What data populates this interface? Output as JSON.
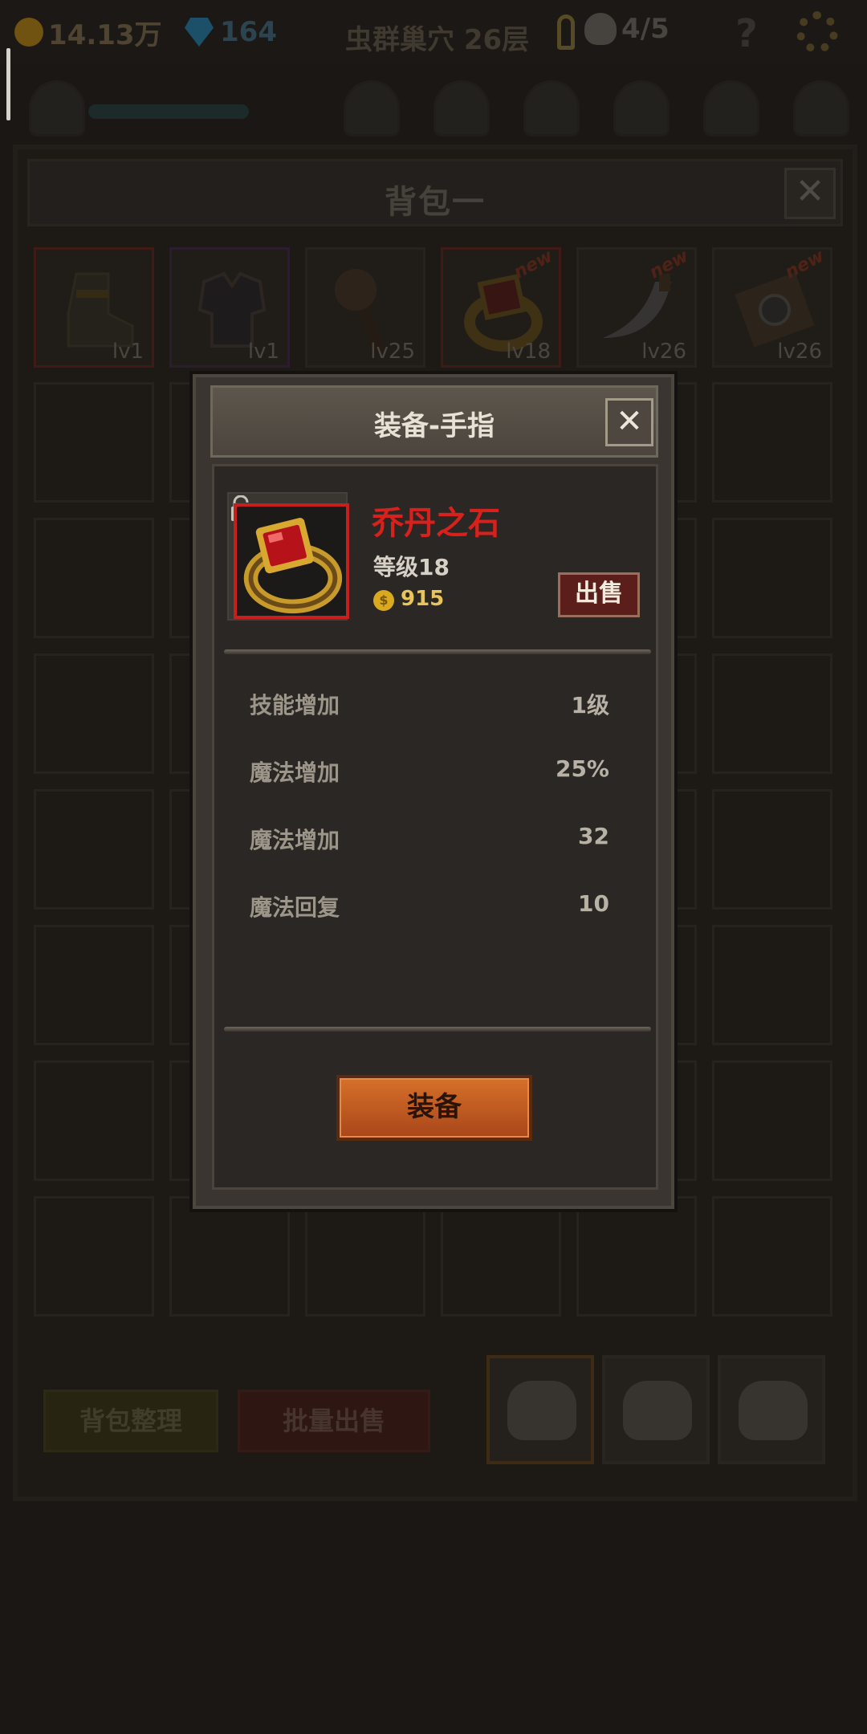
{
  "topbar": {
    "gold": "14.13万",
    "gems": "164",
    "dungeon_title": "虫群巢穴 26层",
    "skulls": "4/5",
    "help": "?"
  },
  "bag": {
    "title": "背包一",
    "close": "✕",
    "items": [
      {
        "name": "boots",
        "level": "lv1",
        "new": ""
      },
      {
        "name": "chest-armor",
        "level": "lv1",
        "new": ""
      },
      {
        "name": "club",
        "level": "lv25",
        "new": ""
      },
      {
        "name": "ring",
        "level": "lv18",
        "new": "new"
      },
      {
        "name": "blade",
        "level": "lv26",
        "new": "new"
      },
      {
        "name": "shield",
        "level": "lv26",
        "new": "new"
      }
    ],
    "tidy_label": "背包整理",
    "bulk_sell_label": "批量出售"
  },
  "modal": {
    "title": "装备-手指",
    "close": "✕",
    "item_name": "乔丹之石",
    "item_level": "等级18",
    "price": "915",
    "coin_glyph": "$",
    "sell_label": "出售",
    "stats": [
      {
        "label": "技能增加",
        "value": "1级"
      },
      {
        "label": "魔法增加",
        "value": "25%"
      },
      {
        "label": "魔法增加",
        "value": "32"
      },
      {
        "label": "魔法回复",
        "value": "10"
      }
    ],
    "equip_label": "装备"
  },
  "colors": {
    "item_name_red": "#d6211c",
    "equip_orange": "#c85f22",
    "price_gold": "#e7c45c"
  }
}
